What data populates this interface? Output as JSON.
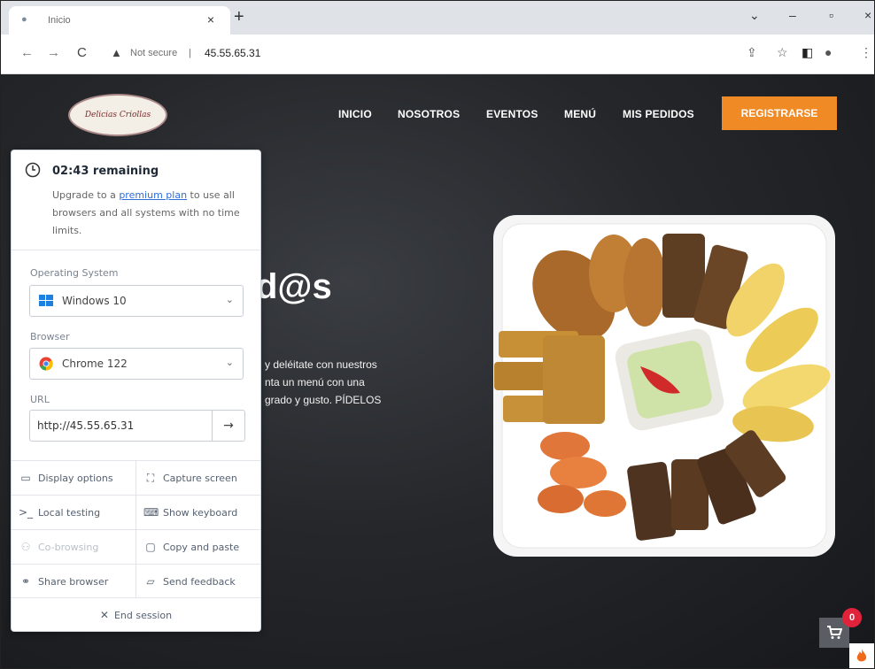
{
  "browser": {
    "tab_title": "Inicio",
    "new_tab": "+",
    "security_label": "Not secure",
    "url": "45.55.65.31"
  },
  "site": {
    "logo_text": "Delicias Criollas",
    "nav": [
      "INICIO",
      "NOSOTROS",
      "EVENTOS",
      "MENÚ",
      "MIS PEDIDOS"
    ],
    "register_label": "REGISTRARSE",
    "hero_title": "d@s",
    "hero_lines": [
      "y deléitate con nuestros",
      "nta un menú con una",
      "grado y gusto. PÍDELOS"
    ],
    "cart_count": "0"
  },
  "panel": {
    "timer": "02:43 remaining",
    "upgrade_prefix": "Upgrade to a ",
    "upgrade_link": "premium plan",
    "upgrade_suffix": " to use all browsers and all systems with no time limits.",
    "os_label": "Operating System",
    "os_value": "Windows 10",
    "browser_label": "Browser",
    "browser_value": "Chrome 122",
    "url_label": "URL",
    "url_value": "http://45.55.65.31",
    "actions": [
      {
        "label": "Display options",
        "icon": "monitor-icon"
      },
      {
        "label": "Capture screen",
        "icon": "capture-icon"
      },
      {
        "label": "Local testing",
        "icon": "terminal-icon"
      },
      {
        "label": "Show keyboard",
        "icon": "keyboard-icon"
      },
      {
        "label": "Co-browsing",
        "icon": "users-icon"
      },
      {
        "label": "Copy and paste",
        "icon": "clipboard-icon"
      },
      {
        "label": "Share browser",
        "icon": "link-icon"
      },
      {
        "label": "Send feedback",
        "icon": "feedback-icon"
      }
    ],
    "end_session": "End session"
  },
  "colors": {
    "accent": "#f08a24",
    "link": "#2d6ed8",
    "cart_badge": "#e0233a"
  }
}
